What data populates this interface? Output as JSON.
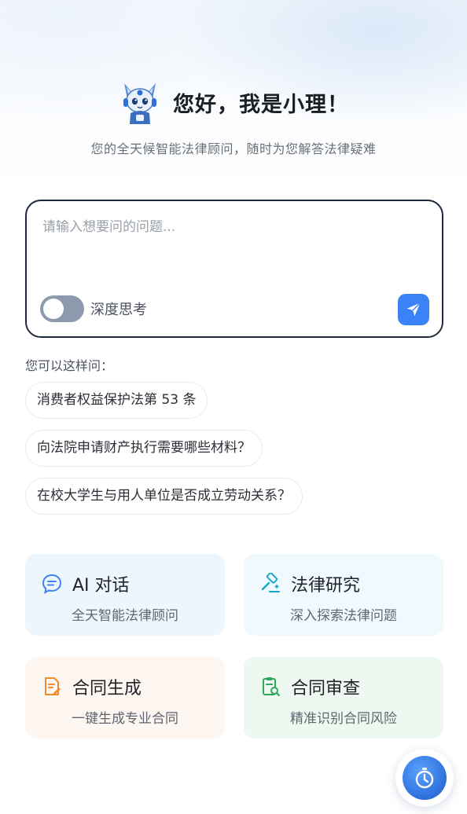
{
  "header": {
    "title": "您好，我是小理！",
    "subtitle": "您的全天候智能法律顾问，随时为您解答法律疑难"
  },
  "input": {
    "placeholder": "请输入想要问的问题...",
    "value": "",
    "deep_think_label": "深度思考",
    "deep_think_enabled": false
  },
  "suggestions": {
    "title": "您可以这样问：",
    "items": [
      "消费者权益保护法第 53 条",
      "向法院申请财产执行需要哪些材料？",
      "在校大学生与用人单位是否成立劳动关系？"
    ]
  },
  "features": [
    {
      "title": "AI 对话",
      "desc": "全天智能法律顾问",
      "icon": "chat-bubble-icon",
      "color": "#3b82f6"
    },
    {
      "title": "法律研究",
      "desc": "深入探索法律问题",
      "icon": "gavel-icon",
      "color": "#17a6c7"
    },
    {
      "title": "合同生成",
      "desc": "一键生成专业合同",
      "icon": "document-edit-icon",
      "color": "#f08c2a"
    },
    {
      "title": "合同审查",
      "desc": "精准识别合同风险",
      "icon": "document-search-icon",
      "color": "#2fa85a"
    }
  ],
  "colors": {
    "accent": "#3b82f6",
    "input_border": "#1d2a3d",
    "toggle_off": "#8d99ac"
  }
}
